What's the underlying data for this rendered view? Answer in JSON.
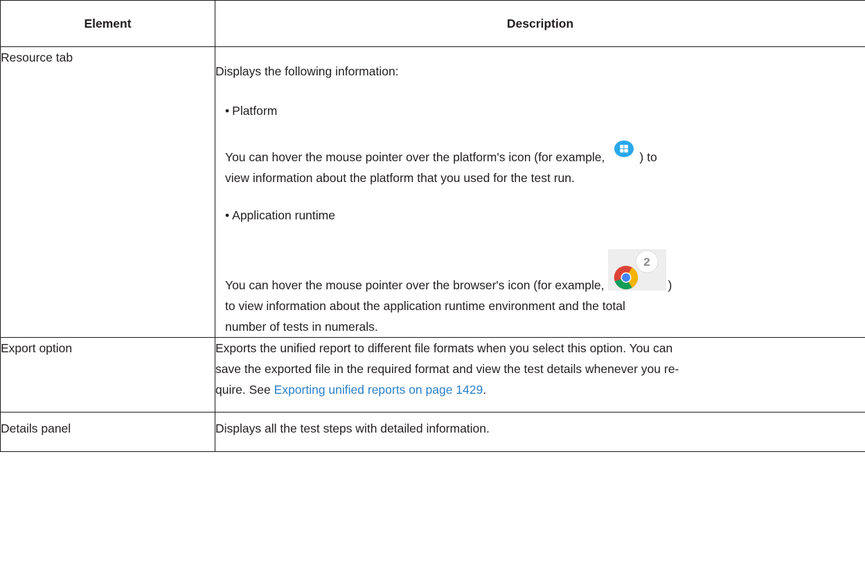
{
  "table": {
    "headers": {
      "element": "Element",
      "description": "Description"
    },
    "rows": {
      "resource": {
        "element": "Resource tab",
        "intro": "Displays the following information:",
        "platform_bullet": "Platform",
        "platform_text_before": "You can hover the mouse pointer over the platform's icon (for example,",
        "platform_text_after": ") to",
        "platform_text_line2": "view information about the platform that you used for the test run.",
        "runtime_bullet": "Application runtime",
        "runtime_text_before": "You can hover the mouse pointer over the browser's icon (for example,",
        "runtime_text_after": ")",
        "runtime_text_line2": "to view information about the application runtime environment and the total",
        "runtime_text_line3": "number of tests in numerals.",
        "browser_badge_count": "2"
      },
      "export": {
        "element": "Export option",
        "line1": "Exports the unified report to different file formats when you select this option. You can",
        "line2": "save the exported file in the required format and view the test details whenever you re-",
        "line3_before": "quire. See ",
        "line3_link": "Exporting unified reports on page 1429",
        "line3_after": "."
      },
      "details": {
        "element": "Details panel",
        "description": "Displays all the test steps with detailed information."
      }
    }
  },
  "icons": {
    "platform_icon": "windows-icon",
    "browser_icon": "chrome-icon"
  },
  "colors": {
    "link": "#2a7fc9",
    "windows_icon_bg": "#29a8e9",
    "border": "#1a1a1a"
  }
}
